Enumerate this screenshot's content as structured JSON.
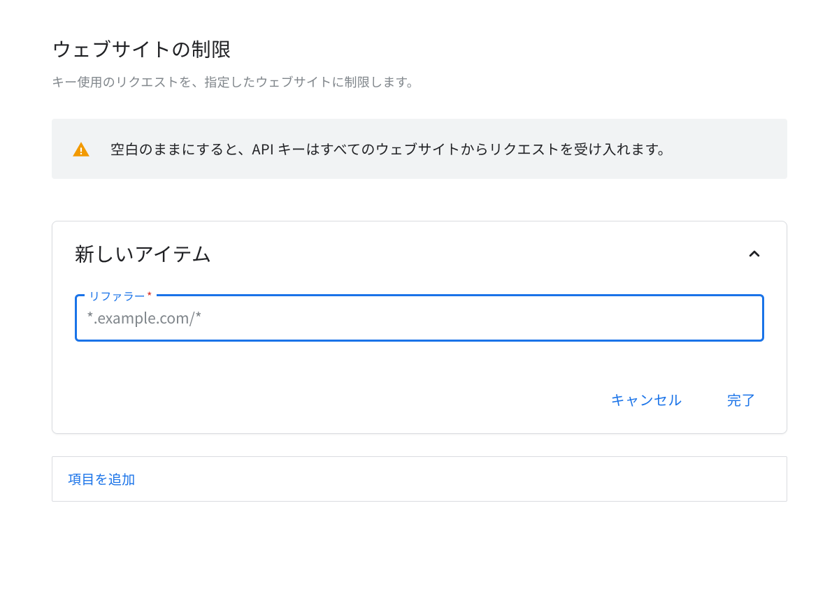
{
  "header": {
    "title": "ウェブサイトの制限",
    "subtitle": "キー使用のリクエストを、指定したウェブサイトに制限します。"
  },
  "warning": {
    "message": "空白のままにすると、API キーはすべてのウェブサイトからリクエストを受け入れます。"
  },
  "card": {
    "title": "新しいアイテム",
    "field": {
      "label": "リファラー",
      "required_mark": "*",
      "placeholder": "*.example.com/*",
      "value": ""
    },
    "actions": {
      "cancel": "キャンセル",
      "done": "完了"
    }
  },
  "add_item": {
    "label": "項目を追加"
  },
  "colors": {
    "primary": "#1a73e8",
    "warning": "#f29900"
  }
}
